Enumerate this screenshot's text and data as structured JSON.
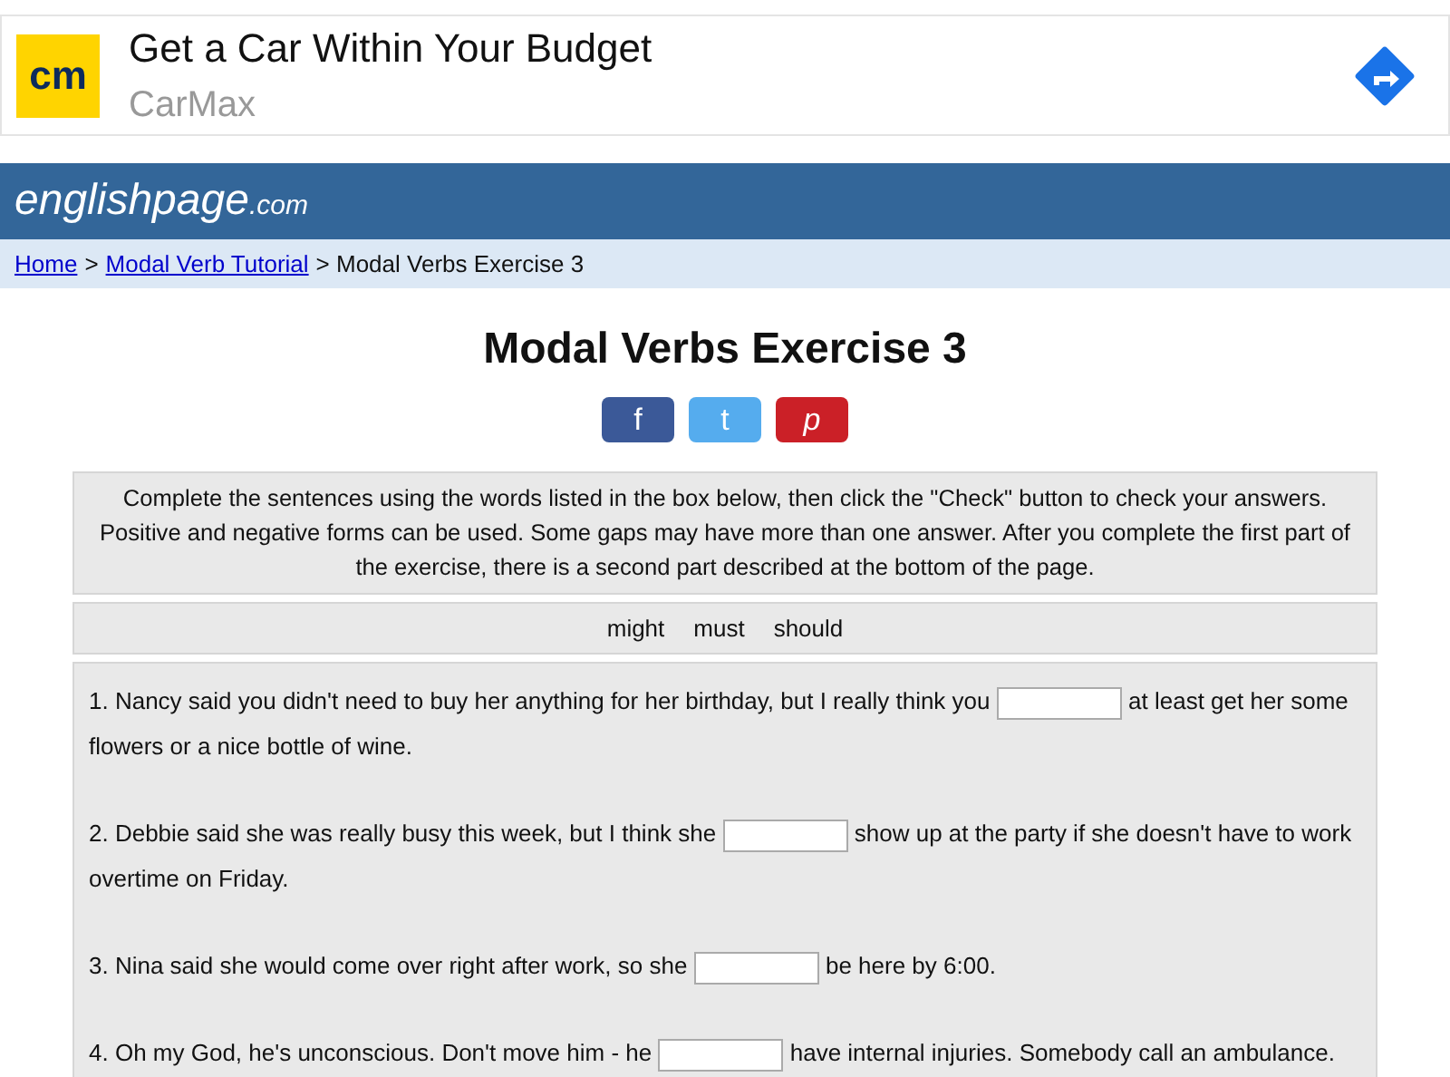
{
  "ad": {
    "headline": "Get a Car Within Your Budget",
    "advertiser": "CarMax",
    "logo_text": "cm"
  },
  "site": {
    "name": "englishpage",
    "suffix": ".com"
  },
  "breadcrumb": [
    {
      "label": "Home",
      "kind": "link"
    },
    {
      "label": ">",
      "kind": "sep"
    },
    {
      "label": "Modal Verb Tutorial",
      "kind": "link"
    },
    {
      "label": "> Modal Verbs Exercise 3",
      "kind": "text"
    }
  ],
  "title": "Modal Verbs Exercise 3",
  "share_buttons": [
    {
      "label": "f",
      "color": "#3b5998"
    },
    {
      "label": "t",
      "color": "#55acee"
    },
    {
      "label": "p",
      "color": "#cb2027"
    }
  ],
  "instructions": "Complete the sentences using the words listed in the box below, then click the \"Check\" button to check your answers. Positive and negative forms can be used. Some gaps may have more than one answer. After you complete the first part of the exercise, there is a second part described at the bottom of the page.",
  "word_bank": [
    "might",
    "must",
    "should"
  ],
  "sentences": [
    {
      "before": "1. Nancy said you didn't need to buy her anything for her birthday, but I really think you",
      "after": "at least get her some",
      "continued": "flowers or a nice bottle of wine."
    },
    {
      "before": "2. Debbie said she was really busy this week, but I think she",
      "after": "show up at the party if she doesn't have to work",
      "continued": "overtime on Friday."
    },
    {
      "before": "3. Nina said she would come over right after work, so she",
      "after": "be here by 6:00."
    },
    {
      "before": "4. Oh my God, he's unconscious. Don't move him - he",
      "after": "have internal injuries. Somebody call an ambulance."
    }
  ]
}
